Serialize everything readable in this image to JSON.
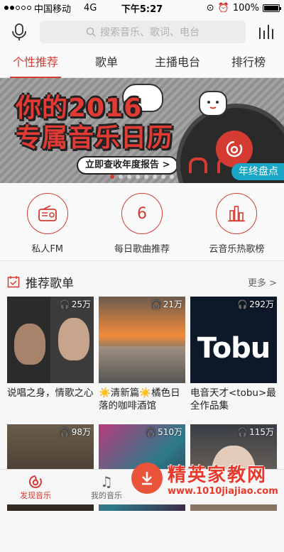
{
  "status_bar": {
    "carrier": "中国移动",
    "network": "4G",
    "time": "下午5:27",
    "battery": "100%"
  },
  "search": {
    "placeholder": "搜索音乐、歌词、电台"
  },
  "tabs": [
    {
      "label": "个性推荐",
      "active": true
    },
    {
      "label": "歌单",
      "active": false
    },
    {
      "label": "主播电台",
      "active": false
    },
    {
      "label": "排行榜",
      "active": false
    }
  ],
  "banner": {
    "title_line1": "你的2016",
    "title_line2": "专属音乐日历",
    "cta": "立即查收年度报告 >",
    "tag": "年终盘点",
    "dots_total": 8,
    "dots_active": 0
  },
  "quick_entries": [
    {
      "label": "私人FM",
      "icon": "radio-icon"
    },
    {
      "label": "每日歌曲推荐",
      "icon": "calendar-day-icon",
      "value": "6"
    },
    {
      "label": "云音乐热歌榜",
      "icon": "chart-bars-icon"
    }
  ],
  "section": {
    "title": "推荐歌单",
    "more": "更多 >"
  },
  "playlists": [
    {
      "title": "说唱之身，情歌之心",
      "plays": "25万"
    },
    {
      "title": "☀️清新篇☀️橘色日落的咖啡酒馆",
      "plays": "21万"
    },
    {
      "title": "电音天才<tobu>最全作品集",
      "plays": "292万",
      "cover_text": "Tobu"
    },
    {
      "title": "",
      "plays": "98万"
    },
    {
      "title": "",
      "plays": "510万"
    },
    {
      "title": "",
      "plays": "115万"
    }
  ],
  "bottom_nav": [
    {
      "label": "发现音乐",
      "active": true
    },
    {
      "label": "我的音乐",
      "active": false
    }
  ],
  "watermark": {
    "title": "精英家教网",
    "url": "www.1010jiajiao.com"
  },
  "colors": {
    "accent": "#d43c33"
  }
}
